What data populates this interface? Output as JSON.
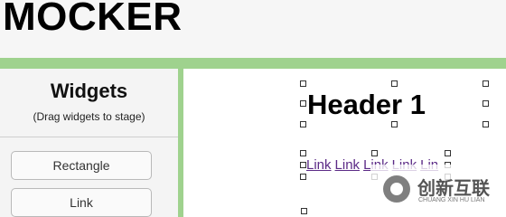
{
  "app": {
    "title": "MOCKER"
  },
  "sidebar": {
    "title": "Widgets",
    "subtitle": "(Drag widgets to stage)",
    "widgets": [
      {
        "label": "Rectangle"
      },
      {
        "label": "Link"
      }
    ]
  },
  "stage": {
    "header_text": "Header 1",
    "links": [
      "Link",
      "Link",
      "Link",
      "Link",
      "Lin"
    ]
  },
  "watermark": {
    "brand_cn": "创新互联",
    "brand_en": "CHUANG XIN HU LIAN"
  },
  "colors": {
    "accent_green": "#9fd28e",
    "link_purple": "#5b2a86"
  },
  "icons": {
    "watermark_logo": "brand-logo-icon"
  }
}
